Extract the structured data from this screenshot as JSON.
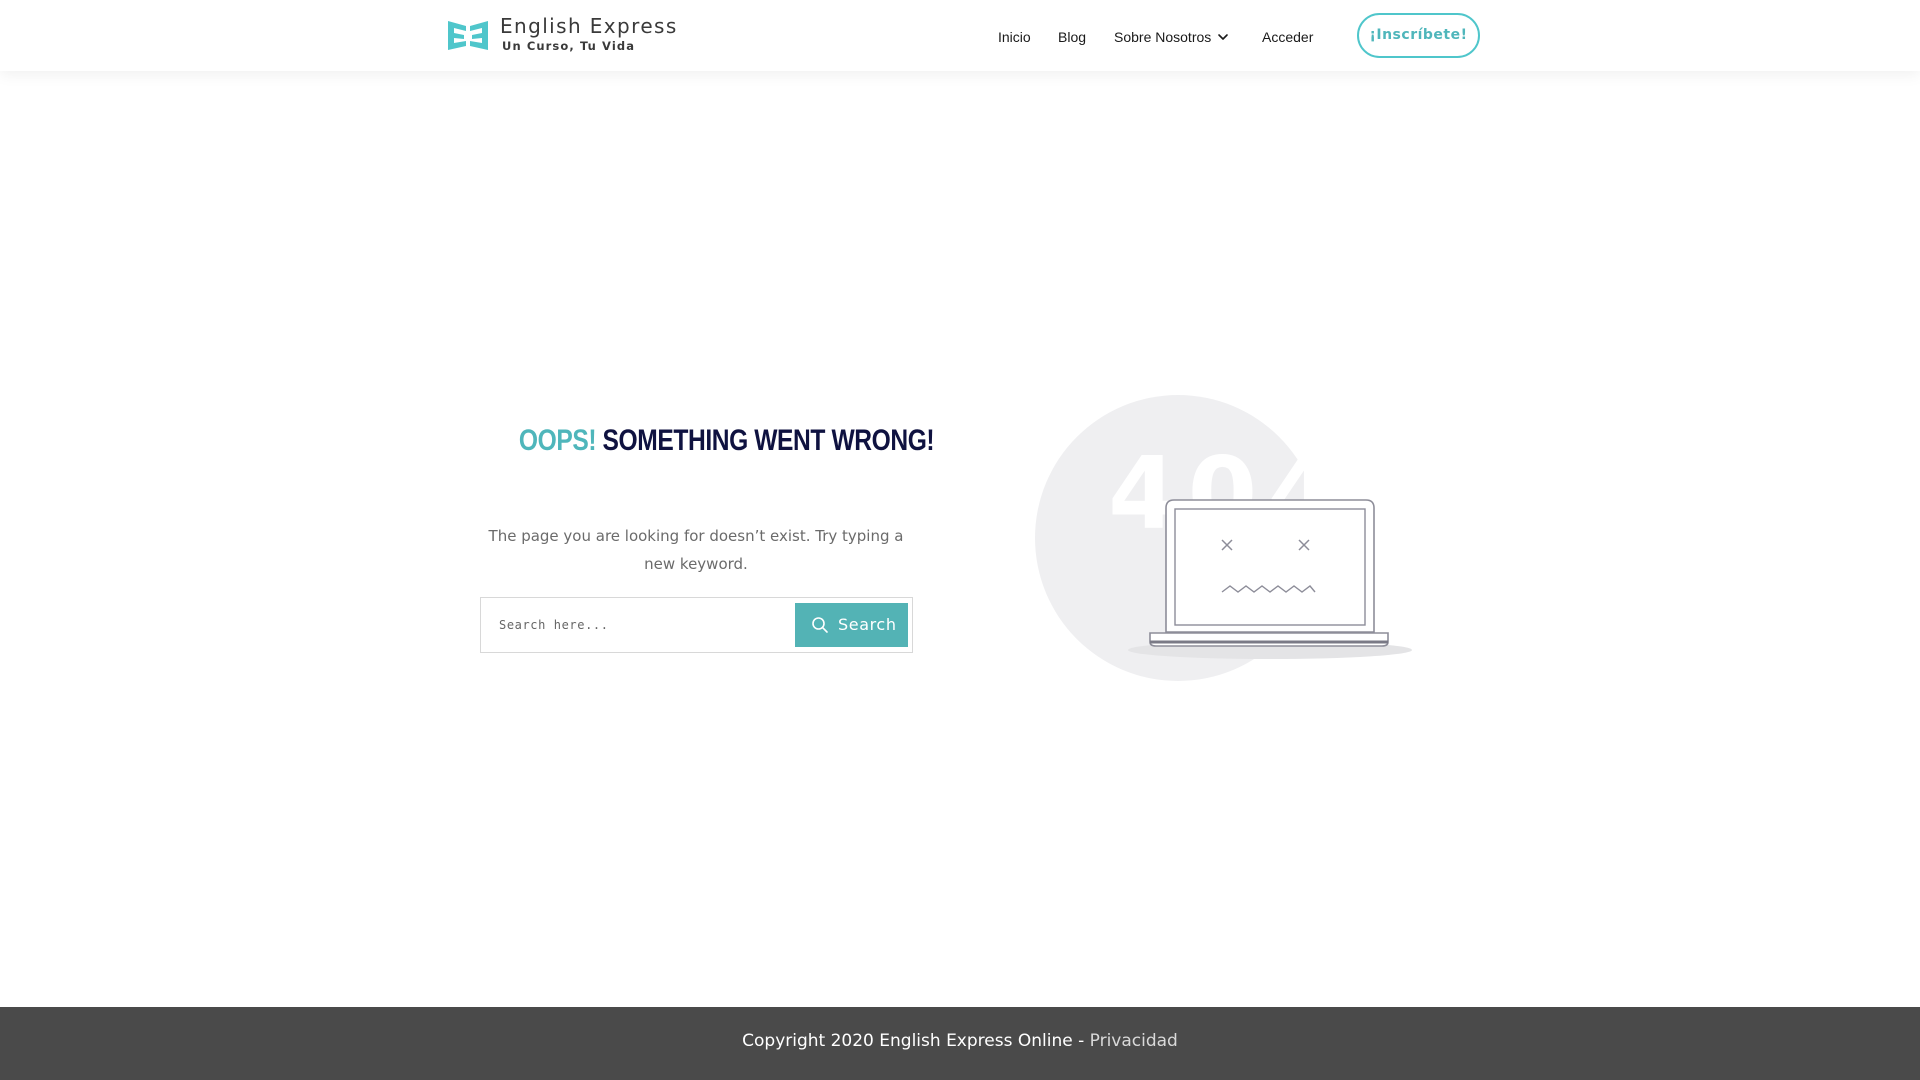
{
  "brand": {
    "name": "English Express",
    "tagline": "Un Curso, Tu Vida",
    "accent_color": "#4fb6bb",
    "dark_color": "#0f1240"
  },
  "nav": {
    "items": [
      {
        "label": "Inicio"
      },
      {
        "label": "Blog"
      },
      {
        "label": "Sobre Nosotros",
        "has_dropdown": true
      },
      {
        "label": "Acceder"
      }
    ],
    "cta_label": "¡Inscríbete!"
  },
  "error": {
    "title_accent": "Oops!",
    "title_rest": "Something went wrong!",
    "description": "The page you are looking for doesn’t exist. Try typing a new keyword.",
    "illustration_code": "404"
  },
  "search": {
    "placeholder": "Search here...",
    "button_label": "Search",
    "button_icon": "search-icon"
  },
  "footer": {
    "copyright": "Copyright 2020 English Express Online - ",
    "privacy_label": "Privacidad",
    "background_color": "#4a4a4a"
  }
}
